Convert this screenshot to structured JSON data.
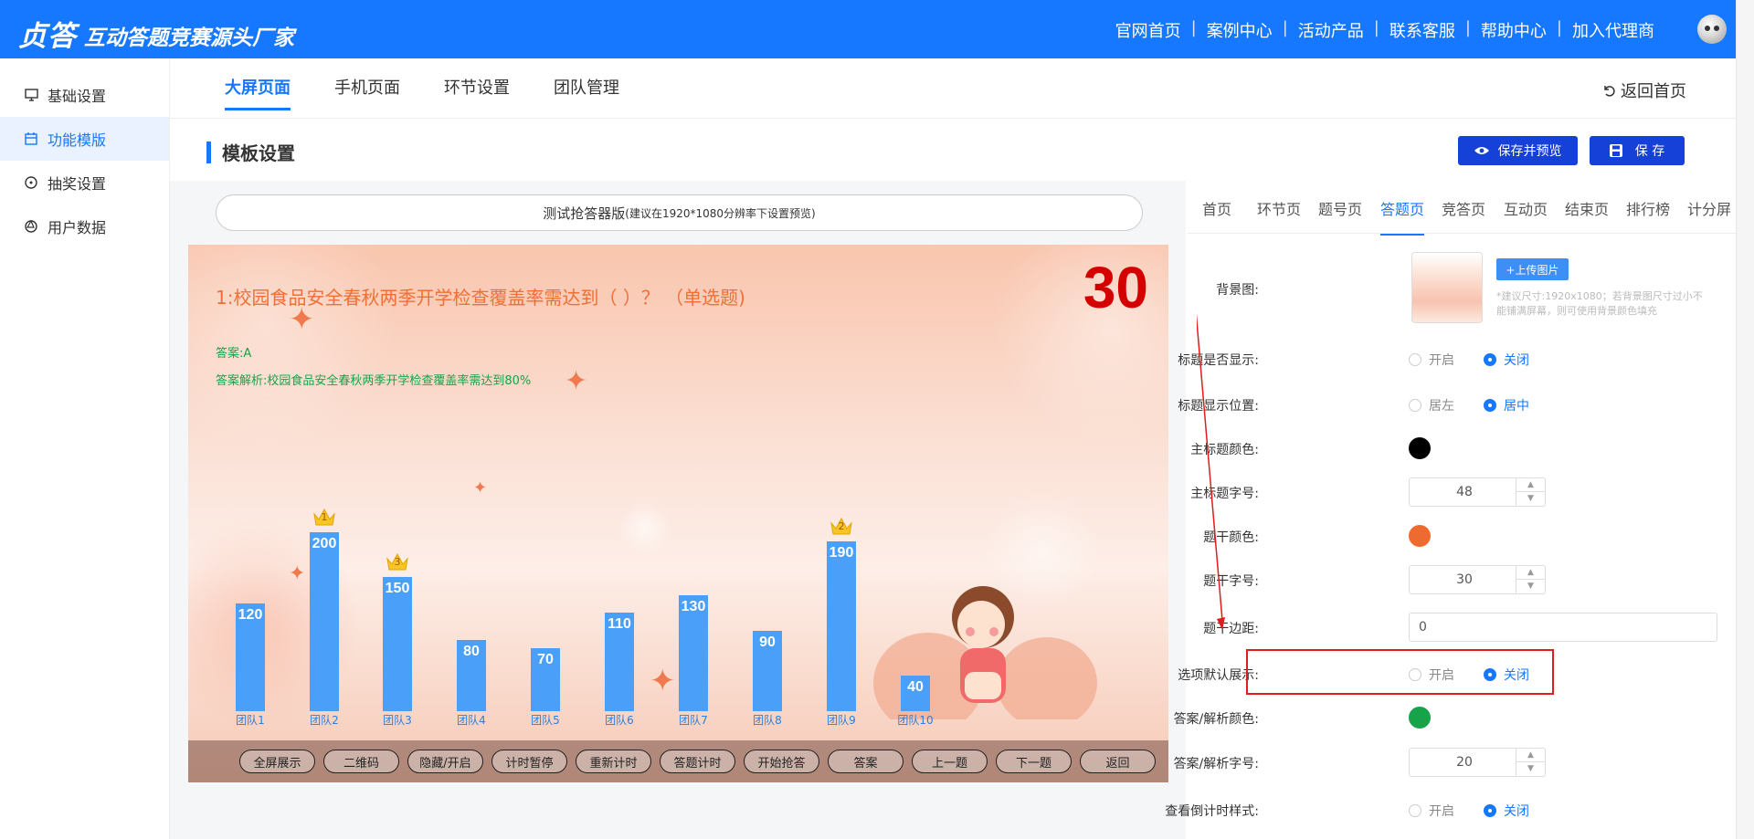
{
  "header": {
    "logo": "贞答",
    "slogan": "互动答题竞赛源头厂家",
    "nav": [
      "官网首页",
      "案例中心",
      "活动产品",
      "联系客服",
      "帮助中心",
      "加入代理商"
    ],
    "nav_separator": "|"
  },
  "sidebar": {
    "items": [
      {
        "label": "基础设置",
        "icon": "monitor-icon"
      },
      {
        "label": "功能模版",
        "icon": "calendar-icon"
      },
      {
        "label": "抽奖设置",
        "icon": "compass-icon"
      },
      {
        "label": "用户数据",
        "icon": "aperture-icon"
      }
    ],
    "active_index": 1
  },
  "tabs": {
    "items": [
      "大屏页面",
      "手机页面",
      "环节设置",
      "团队管理"
    ],
    "active_index": 0,
    "back_home": "返回首页"
  },
  "section": {
    "title": "模板设置",
    "save_preview": "保存并预览",
    "save": "保 存"
  },
  "preview": {
    "title": "测试抢答器版",
    "title_hint": "(建议在1920*1080分辨率下设置预览)",
    "question": "1:校园食品安全春秋两季开学检查覆盖率需达到（ ）？ （单选题)",
    "timer": "30",
    "answer": "答案:A",
    "analysis": "答案解析:校园食品安全春秋两季开学检查覆盖率需达到80%",
    "controls": [
      "全屏展示",
      "二维码",
      "隐藏/开启",
      "计时暂停",
      "重新计时",
      "答题计时",
      "开始抢答",
      "答案",
      "上一题",
      "下一题",
      "返回"
    ]
  },
  "chart_data": {
    "type": "bar",
    "categories": [
      "团队1",
      "团队2",
      "团队3",
      "团队4",
      "团队5",
      "团队6",
      "团队7",
      "团队8",
      "团队9",
      "团队10"
    ],
    "values": [
      120,
      200,
      150,
      80,
      70,
      110,
      130,
      90,
      190,
      40
    ],
    "ranks": {
      "团队2": "1",
      "团队9": "2",
      "团队3": "3"
    },
    "bar_color": "#4aa0f8"
  },
  "settings": {
    "subtabs": [
      "首页",
      "环节页",
      "题号页",
      "答题页",
      "竞答页",
      "互动页",
      "结束页",
      "排行榜",
      "计分屏"
    ],
    "active_subtab": 3,
    "upload_label": "+上传图片",
    "bg_hint": "*建议尺寸:1920x1080；若背景图尺寸过小不能铺满屏幕，则可使用背景颜色填充",
    "rows": {
      "bg": "背景图:",
      "title_show": "标题是否显示:",
      "title_pos": "标题显示位置:",
      "main_title_color": "主标题颜色:",
      "main_title_size": "主标题字号:",
      "stem_color": "题干颜色:",
      "stem_size": "题干字号:",
      "stem_margin": "题干边距:",
      "option_default": "选项默认展示:",
      "answer_color": "答案/解析颜色:",
      "answer_size": "答案/解析字号:",
      "countdown_style": "查看倒计时样式:"
    },
    "opt_on": "开启",
    "opt_off": "关闭",
    "opt_left": "居左",
    "opt_center": "居中",
    "values": {
      "main_title_size": "48",
      "stem_size": "30",
      "stem_margin": "0",
      "answer_size": "20"
    },
    "colors": {
      "main_title": "#000000",
      "stem": "#ef6a2e",
      "answer": "#16a34a"
    }
  }
}
